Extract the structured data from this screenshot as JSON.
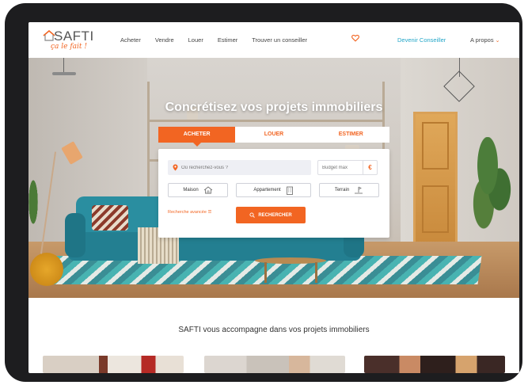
{
  "header": {
    "logo_text": "SAFTI",
    "logo_tagline": "ça le fait !",
    "nav_items": [
      "Acheter",
      "Vendre",
      "Louer",
      "Estimer",
      "Trouver un conseiller"
    ],
    "favorites_icon": "heart-icon",
    "cta_label": "Devenir Conseiller",
    "about_label": "A propos"
  },
  "hero": {
    "title": "Concrétisez vos projets immobiliers",
    "tabs": [
      {
        "label": "ACHETER",
        "active": true
      },
      {
        "label": "LOUER",
        "active": false
      },
      {
        "label": "ESTIMER",
        "active": false
      }
    ],
    "search": {
      "location_placeholder": "Où recherchez-vous ?",
      "budget_placeholder": "Budget max",
      "currency": "€",
      "property_types": [
        {
          "label": "Maison",
          "icon": "house-icon"
        },
        {
          "label": "Appartement",
          "icon": "building-icon"
        },
        {
          "label": "Terrain",
          "icon": "land-icon"
        }
      ],
      "advanced_link": "Recherche avancée",
      "search_button": "RECHERCHER"
    }
  },
  "section": {
    "title": "SAFTI vous accompagne dans vos projets immobiliers"
  },
  "colors": {
    "accent": "#f26522",
    "link": "#23a6c8",
    "device": "#1d1d1f"
  }
}
